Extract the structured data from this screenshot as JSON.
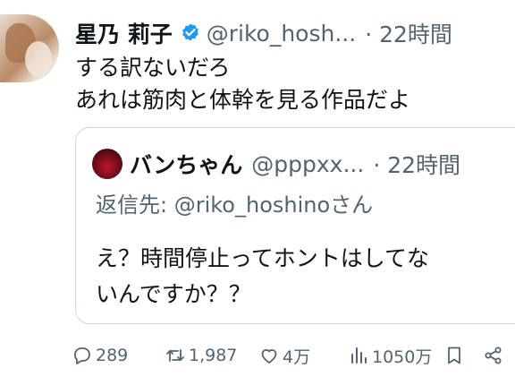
{
  "tweet": {
    "author_name": "星乃 莉子",
    "handle": "@riko_hosh...",
    "time": "· 22時間",
    "lines": [
      "する訳ないだろ",
      "あれは筋肉と体幹を見る作品だよ"
    ]
  },
  "quote": {
    "author_name": "バンちゃん",
    "handle": "@pppxx...",
    "time": "· 22時間",
    "reply_prefix": "返信先: ",
    "reply_mention": "@riko_hoshino",
    "reply_suffix": "さん",
    "lines": [
      "え？時間停止ってホントはしてな",
      "いんですか？？"
    ]
  },
  "actions": {
    "replies": "289",
    "reposts": "1,987",
    "likes": "4万",
    "views": "1050万"
  },
  "colors": {
    "text": "#0f1419",
    "secondary": "#536471",
    "verified": "#1d9bf0",
    "border": "#cfd9de"
  },
  "icons": [
    "verified-badge-icon",
    "reply-icon",
    "repost-icon",
    "like-icon",
    "views-icon",
    "bookmark-icon",
    "share-icon"
  ]
}
